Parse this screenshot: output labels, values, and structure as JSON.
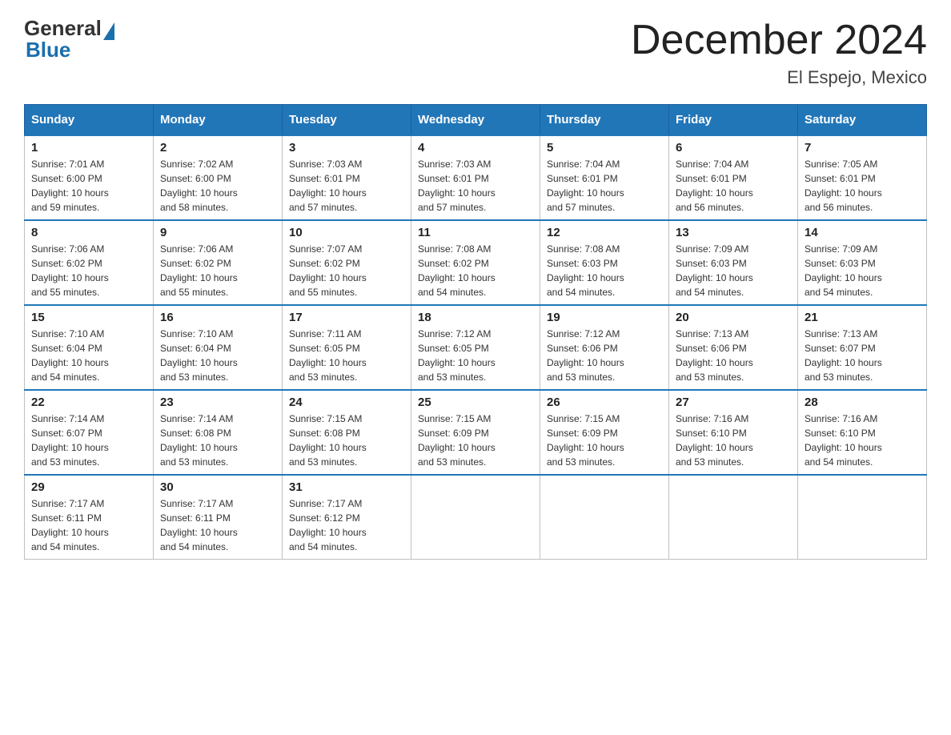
{
  "header": {
    "logo_general": "General",
    "logo_blue": "Blue",
    "month_title": "December 2024",
    "location": "El Espejo, Mexico"
  },
  "weekdays": [
    "Sunday",
    "Monday",
    "Tuesday",
    "Wednesday",
    "Thursday",
    "Friday",
    "Saturday"
  ],
  "weeks": [
    [
      {
        "day": "1",
        "sunrise": "7:01 AM",
        "sunset": "6:00 PM",
        "daylight": "10 hours and 59 minutes."
      },
      {
        "day": "2",
        "sunrise": "7:02 AM",
        "sunset": "6:00 PM",
        "daylight": "10 hours and 58 minutes."
      },
      {
        "day": "3",
        "sunrise": "7:03 AM",
        "sunset": "6:01 PM",
        "daylight": "10 hours and 57 minutes."
      },
      {
        "day": "4",
        "sunrise": "7:03 AM",
        "sunset": "6:01 PM",
        "daylight": "10 hours and 57 minutes."
      },
      {
        "day": "5",
        "sunrise": "7:04 AM",
        "sunset": "6:01 PM",
        "daylight": "10 hours and 57 minutes."
      },
      {
        "day": "6",
        "sunrise": "7:04 AM",
        "sunset": "6:01 PM",
        "daylight": "10 hours and 56 minutes."
      },
      {
        "day": "7",
        "sunrise": "7:05 AM",
        "sunset": "6:01 PM",
        "daylight": "10 hours and 56 minutes."
      }
    ],
    [
      {
        "day": "8",
        "sunrise": "7:06 AM",
        "sunset": "6:02 PM",
        "daylight": "10 hours and 55 minutes."
      },
      {
        "day": "9",
        "sunrise": "7:06 AM",
        "sunset": "6:02 PM",
        "daylight": "10 hours and 55 minutes."
      },
      {
        "day": "10",
        "sunrise": "7:07 AM",
        "sunset": "6:02 PM",
        "daylight": "10 hours and 55 minutes."
      },
      {
        "day": "11",
        "sunrise": "7:08 AM",
        "sunset": "6:02 PM",
        "daylight": "10 hours and 54 minutes."
      },
      {
        "day": "12",
        "sunrise": "7:08 AM",
        "sunset": "6:03 PM",
        "daylight": "10 hours and 54 minutes."
      },
      {
        "day": "13",
        "sunrise": "7:09 AM",
        "sunset": "6:03 PM",
        "daylight": "10 hours and 54 minutes."
      },
      {
        "day": "14",
        "sunrise": "7:09 AM",
        "sunset": "6:03 PM",
        "daylight": "10 hours and 54 minutes."
      }
    ],
    [
      {
        "day": "15",
        "sunrise": "7:10 AM",
        "sunset": "6:04 PM",
        "daylight": "10 hours and 54 minutes."
      },
      {
        "day": "16",
        "sunrise": "7:10 AM",
        "sunset": "6:04 PM",
        "daylight": "10 hours and 53 minutes."
      },
      {
        "day": "17",
        "sunrise": "7:11 AM",
        "sunset": "6:05 PM",
        "daylight": "10 hours and 53 minutes."
      },
      {
        "day": "18",
        "sunrise": "7:12 AM",
        "sunset": "6:05 PM",
        "daylight": "10 hours and 53 minutes."
      },
      {
        "day": "19",
        "sunrise": "7:12 AM",
        "sunset": "6:06 PM",
        "daylight": "10 hours and 53 minutes."
      },
      {
        "day": "20",
        "sunrise": "7:13 AM",
        "sunset": "6:06 PM",
        "daylight": "10 hours and 53 minutes."
      },
      {
        "day": "21",
        "sunrise": "7:13 AM",
        "sunset": "6:07 PM",
        "daylight": "10 hours and 53 minutes."
      }
    ],
    [
      {
        "day": "22",
        "sunrise": "7:14 AM",
        "sunset": "6:07 PM",
        "daylight": "10 hours and 53 minutes."
      },
      {
        "day": "23",
        "sunrise": "7:14 AM",
        "sunset": "6:08 PM",
        "daylight": "10 hours and 53 minutes."
      },
      {
        "day": "24",
        "sunrise": "7:15 AM",
        "sunset": "6:08 PM",
        "daylight": "10 hours and 53 minutes."
      },
      {
        "day": "25",
        "sunrise": "7:15 AM",
        "sunset": "6:09 PM",
        "daylight": "10 hours and 53 minutes."
      },
      {
        "day": "26",
        "sunrise": "7:15 AM",
        "sunset": "6:09 PM",
        "daylight": "10 hours and 53 minutes."
      },
      {
        "day": "27",
        "sunrise": "7:16 AM",
        "sunset": "6:10 PM",
        "daylight": "10 hours and 53 minutes."
      },
      {
        "day": "28",
        "sunrise": "7:16 AM",
        "sunset": "6:10 PM",
        "daylight": "10 hours and 54 minutes."
      }
    ],
    [
      {
        "day": "29",
        "sunrise": "7:17 AM",
        "sunset": "6:11 PM",
        "daylight": "10 hours and 54 minutes."
      },
      {
        "day": "30",
        "sunrise": "7:17 AM",
        "sunset": "6:11 PM",
        "daylight": "10 hours and 54 minutes."
      },
      {
        "day": "31",
        "sunrise": "7:17 AM",
        "sunset": "6:12 PM",
        "daylight": "10 hours and 54 minutes."
      },
      null,
      null,
      null,
      null
    ]
  ],
  "labels": {
    "sunrise": "Sunrise:",
    "sunset": "Sunset:",
    "daylight": "Daylight:"
  }
}
